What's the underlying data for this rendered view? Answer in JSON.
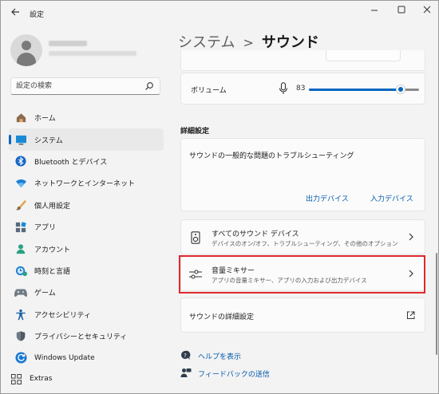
{
  "window": {
    "title": "設定",
    "back_icon": "arrow-left-icon",
    "minimize_icon": "minimize-icon",
    "maximize_icon": "maximize-icon",
    "close_icon": "close-icon"
  },
  "profile": {
    "avatar_icon": "user-avatar-icon"
  },
  "search": {
    "placeholder": "設定の検索",
    "icon": "search-icon"
  },
  "sidebar": {
    "items": [
      {
        "label": "ホーム",
        "icon": "home-icon",
        "selected": false
      },
      {
        "label": "システム",
        "icon": "system-display-icon",
        "selected": true
      },
      {
        "label": "Bluetooth とデバイス",
        "icon": "bluetooth-icon",
        "selected": false
      },
      {
        "label": "ネットワークとインターネット",
        "icon": "wifi-icon",
        "selected": false
      },
      {
        "label": "個人用設定",
        "icon": "paintbrush-icon",
        "selected": false
      },
      {
        "label": "アプリ",
        "icon": "apps-icon",
        "selected": false
      },
      {
        "label": "アカウント",
        "icon": "account-icon",
        "selected": false
      },
      {
        "label": "時刻と言語",
        "icon": "clock-globe-icon",
        "selected": false
      },
      {
        "label": "ゲーム",
        "icon": "gamepad-icon",
        "selected": false
      },
      {
        "label": "アクセシビリティ",
        "icon": "accessibility-icon",
        "selected": false
      },
      {
        "label": "プライバシーとセキュリティ",
        "icon": "shield-icon",
        "selected": false
      },
      {
        "label": "Windows Update",
        "icon": "windows-update-icon",
        "selected": false
      }
    ],
    "extras": {
      "label": "Extras",
      "icon": "extras-grid-icon"
    }
  },
  "breadcrumb": {
    "parent": "システム",
    "separator": ">",
    "current": "サウンド"
  },
  "volume": {
    "label": "ボリューム",
    "value": "83",
    "level": 0.83,
    "icon": "microphone-icon"
  },
  "advanced": {
    "section_title": "詳細設定",
    "troubleshoot_title": "サウンドの一般的な問題のトラブルシューティング",
    "output_devices_link": "出力デバイス",
    "input_devices_link": "入力デバイス",
    "rows": [
      {
        "title": "すべてのサウンド デバイス",
        "subtitle": "デバイスのオン/オフ、トラブルシューティング、その他のオプション",
        "icon": "speaker-device-icon"
      },
      {
        "title": "音量ミキサー",
        "subtitle": "アプリの音量ミキサー、アプリの入力および出力デバイス",
        "icon": "mixer-sliders-icon",
        "highlighted": true
      }
    ],
    "more_settings": {
      "title": "サウンドの詳細設定",
      "icon": "external-link-icon"
    }
  },
  "help": {
    "show_help": "ヘルプを表示",
    "feedback": "フィードバックの送信"
  },
  "colors": {
    "accent": "#0067c0",
    "highlight_border": "#e0282e",
    "link": "#0058ad"
  }
}
